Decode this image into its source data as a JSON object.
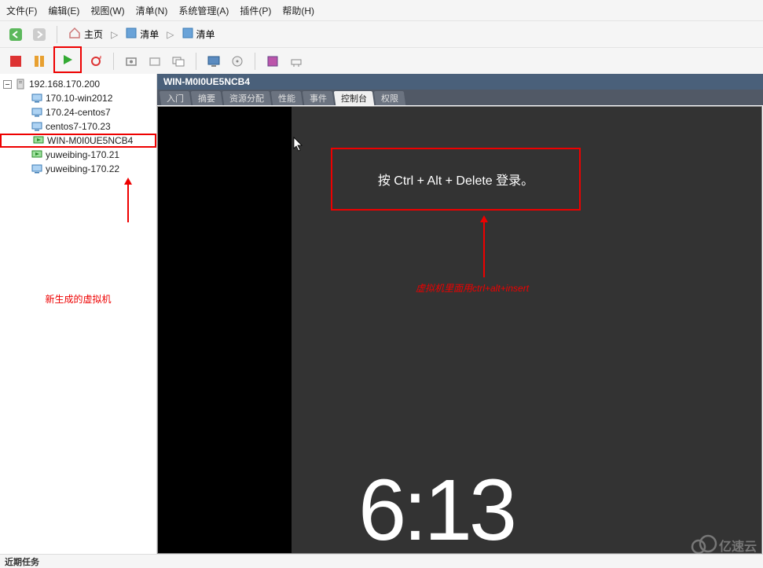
{
  "menu": {
    "file": "文件(F)",
    "edit": "编辑(E)",
    "view": "视图(W)",
    "inventory": "清单(N)",
    "admin": "系统管理(A)",
    "plugins": "插件(P)",
    "help": "帮助(H)"
  },
  "breadcrumb": {
    "home": "主页",
    "inv1": "清单",
    "inv2": "清单"
  },
  "tree": {
    "root": "192.168.170.200",
    "items": [
      "170.10-win2012",
      "170.24-centos7",
      "centos7-170.23",
      "WIN-M0I0UE5NCB4",
      "yuweibing-170.21",
      "yuweibing-170.22"
    ]
  },
  "annotations": {
    "new_vm": "新生成的虚拟机",
    "ctrl_hint": "虚拟机里面用ctrl+alt+insert"
  },
  "right": {
    "title": "WIN-M0I0UE5NCB4",
    "tabs": [
      "入门",
      "摘要",
      "资源分配",
      "性能",
      "事件",
      "控制台",
      "权限"
    ],
    "active_tab_index": 5,
    "login_text": "按 Ctrl + Alt + Delete 登录。",
    "clock": "6:13"
  },
  "status": "近期任务",
  "watermark": "亿速云",
  "colors": {
    "highlight": "#e00",
    "console_bg": "#333"
  }
}
